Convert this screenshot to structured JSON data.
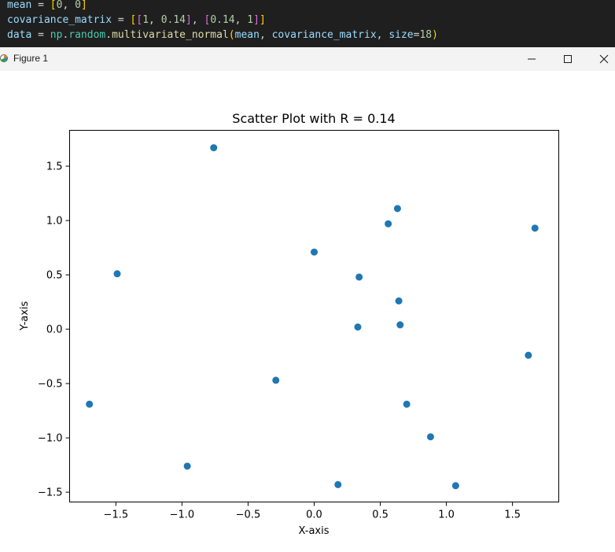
{
  "editor": {
    "line1": {
      "var": "mean",
      "op": " = ",
      "open": "[",
      "v1": "0",
      "sep": ", ",
      "v2": "0",
      "close": "]"
    },
    "line2": {
      "var": "covariance_matrix",
      "op": " = ",
      "o1": "[",
      "o2": "[",
      "a": "1",
      "s1": ", ",
      "b": "0.14",
      "c1": "]",
      "s2": ", ",
      "o3": "[",
      "c": "0.14",
      "s3": ", ",
      "d": "1",
      "c2": "]",
      "c3": "]"
    },
    "line3": {
      "var": "data",
      "op": " = ",
      "mod": "np",
      "dot1": ".",
      "mod2": "random",
      "dot2": ".",
      "fn": "multivariate_normal",
      "open": "(",
      "arg1": "mean",
      "s1": ", ",
      "arg2": "covariance_matrix",
      "s2": ", ",
      "kw": "size",
      "eq": "=",
      "num": "18",
      "close": ")"
    }
  },
  "window": {
    "title": "Figure 1",
    "icon": "matplotlib-icon",
    "controls": [
      "minimize-icon",
      "maximize-icon",
      "close-icon"
    ]
  },
  "chart_data": {
    "type": "scatter",
    "title": "Scatter Plot with R = 0.14",
    "xlabel": "X-axis",
    "ylabel": "Y-axis",
    "xlim": [
      -1.85,
      1.85
    ],
    "ylim": [
      -1.59,
      1.83
    ],
    "xticks": [
      -1.5,
      -1.0,
      -0.5,
      0.0,
      0.5,
      1.0,
      1.5
    ],
    "xtick_labels": [
      "−1.5",
      "−1.0",
      "−0.5",
      "0.0",
      "0.5",
      "1.0",
      "1.5"
    ],
    "yticks": [
      -1.5,
      -1.0,
      -0.5,
      0.0,
      0.5,
      1.0,
      1.5
    ],
    "ytick_labels": [
      "−1.5",
      "−1.0",
      "−0.5",
      "0.0",
      "0.5",
      "1.0",
      "1.5"
    ],
    "grid": false,
    "color": "#1f77b4",
    "points": [
      {
        "x": -0.76,
        "y": 1.67
      },
      {
        "x": -1.49,
        "y": 0.51
      },
      {
        "x": -1.7,
        "y": -0.69
      },
      {
        "x": -0.96,
        "y": -1.26
      },
      {
        "x": -0.29,
        "y": -0.47
      },
      {
        "x": 0.0,
        "y": 0.71
      },
      {
        "x": 0.34,
        "y": 0.48
      },
      {
        "x": 0.33,
        "y": 0.02
      },
      {
        "x": 0.18,
        "y": -1.43
      },
      {
        "x": 0.56,
        "y": 0.97
      },
      {
        "x": 0.63,
        "y": 1.11
      },
      {
        "x": 0.64,
        "y": 0.26
      },
      {
        "x": 0.65,
        "y": 0.04
      },
      {
        "x": 0.7,
        "y": -0.69
      },
      {
        "x": 0.88,
        "y": -0.99
      },
      {
        "x": 1.07,
        "y": -1.44
      },
      {
        "x": 1.62,
        "y": -0.24
      },
      {
        "x": 1.67,
        "y": 0.93
      }
    ]
  }
}
